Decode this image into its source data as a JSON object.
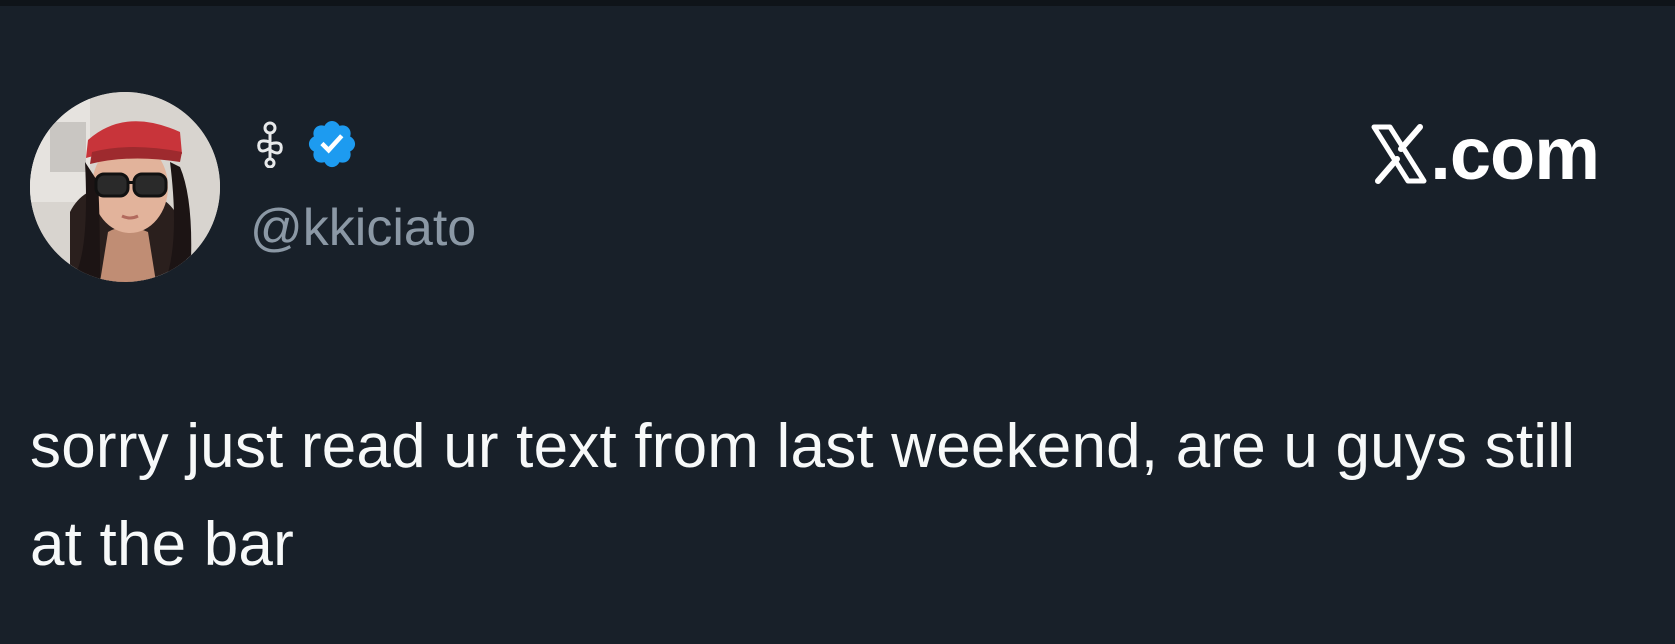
{
  "tweet": {
    "display_name_icon": "ornament-icon",
    "verified_icon": "verified-badge-icon",
    "handle": "@kkiciato",
    "text": "sorry just read ur text from last weekend, are u guys still at the bar"
  },
  "branding": {
    "logo_icon": "x-logo-icon",
    "domain_suffix": ".com"
  },
  "colors": {
    "background": "#182029",
    "text": "#f7f9f9",
    "handle": "#8b98a5",
    "verified": "#1d9bf0"
  }
}
